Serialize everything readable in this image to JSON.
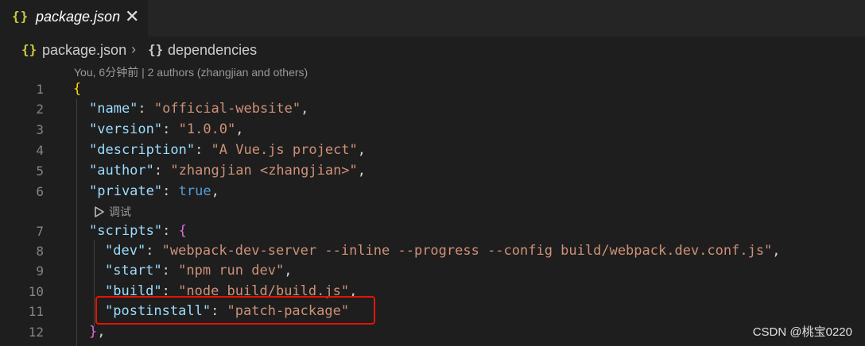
{
  "tab": {
    "icon": "{}",
    "label": "package.json",
    "close": "✕"
  },
  "breadcrumb": {
    "file_icon": "{}",
    "file": "package.json",
    "sep": "›",
    "node_icon": "{}",
    "node": "dependencies"
  },
  "blame": "You, 6分钟前 | 2 authors (zhangjian and others)",
  "codelens": {
    "icon": "play-outline-icon",
    "label": "调试"
  },
  "lines": [
    {
      "n": "1",
      "open": "{"
    },
    {
      "n": "2",
      "key": "\"name\"",
      "val": "\"official-website\"",
      "end": ","
    },
    {
      "n": "3",
      "key": "\"version\"",
      "val": "\"1.0.0\"",
      "end": ","
    },
    {
      "n": "4",
      "key": "\"description\"",
      "val": "\"A Vue.js project\"",
      "end": ","
    },
    {
      "n": "5",
      "key": "\"author\"",
      "val": "\"zhangjian <zhangjian>\"",
      "end": ","
    },
    {
      "n": "6",
      "key": "\"private\"",
      "kw": "true",
      "end": ","
    },
    {
      "n": "7",
      "key": "\"scripts\"",
      "open": "{"
    },
    {
      "n": "8",
      "key": "\"dev\"",
      "val": "\"webpack-dev-server --inline --progress --config build/webpack.dev.conf.js\"",
      "end": ","
    },
    {
      "n": "9",
      "key": "\"start\"",
      "val": "\"npm run dev\"",
      "end": ","
    },
    {
      "n": "10",
      "key": "\"build\"",
      "val": "\"node build/build.js\"",
      "end": ","
    },
    {
      "n": "11",
      "key": "\"postinstall\"",
      "val": "\"patch-package\""
    },
    {
      "n": "12",
      "close": "}",
      "end": ","
    }
  ],
  "colon": ": ",
  "watermark": "CSDN @桃宝0220",
  "colors": {
    "key": "#9cdcfe",
    "string": "#ce9178",
    "keyword": "#569cd6",
    "highlight_box": "#e51400"
  }
}
